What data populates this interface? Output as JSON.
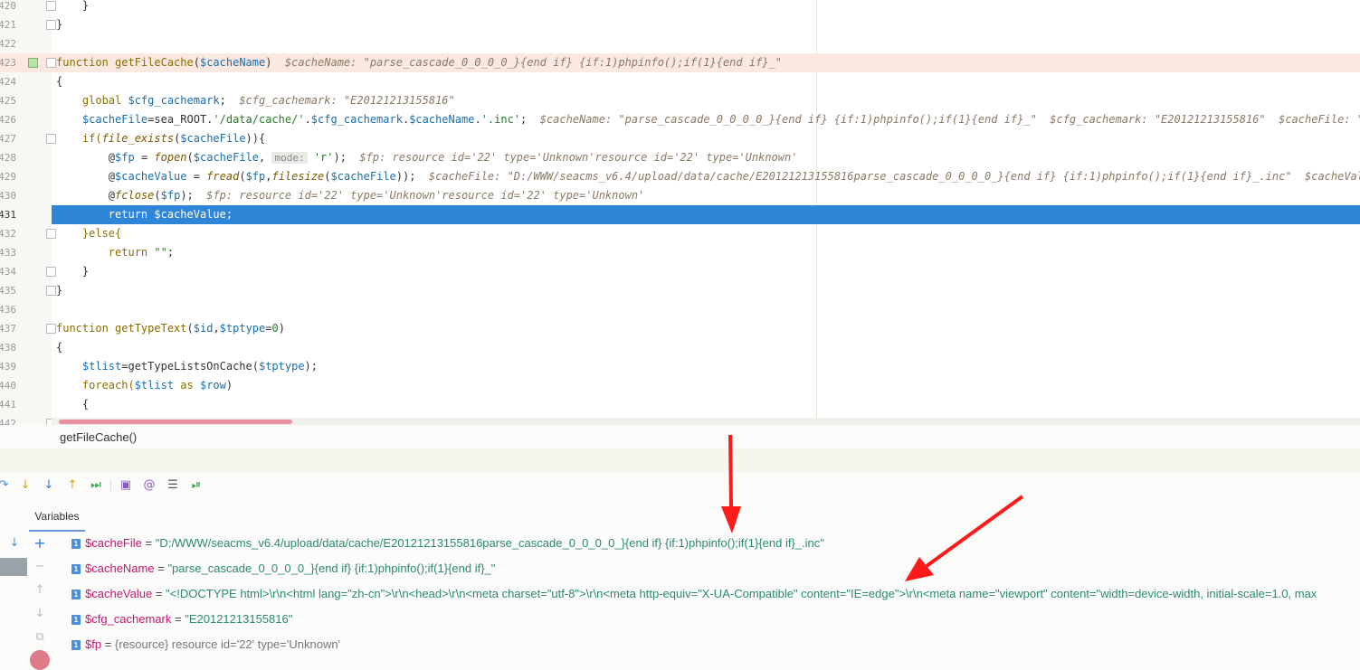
{
  "editor": {
    "lines": [
      {
        "num": "420",
        "segments": [
          {
            "t": "    }",
            "c": ""
          }
        ]
      },
      {
        "num": "421",
        "segments": [
          {
            "t": "}",
            "c": ""
          }
        ]
      },
      {
        "num": "422",
        "segments": []
      },
      {
        "num": "423",
        "segments": [
          {
            "t": "function ",
            "c": "kw"
          },
          {
            "t": "getFileCache",
            "c": "fn"
          },
          {
            "t": "(",
            "c": ""
          },
          {
            "t": "$cacheName",
            "c": "var"
          },
          {
            "t": ")  ",
            "c": ""
          },
          {
            "t": "$cacheName: \"parse_cascade_0_0_0_0_}{end if} {if:1)phpinfo();if(1}{end if}_\"",
            "c": "hint"
          }
        ]
      },
      {
        "num": "424",
        "segments": [
          {
            "t": "{",
            "c": ""
          }
        ]
      },
      {
        "num": "425",
        "segments": [
          {
            "t": "    global ",
            "c": "kw"
          },
          {
            "t": "$cfg_cachemark",
            "c": "var"
          },
          {
            "t": ";  ",
            "c": ""
          },
          {
            "t": "$cfg_cachemark: \"E20121213155816\"",
            "c": "hint"
          }
        ]
      },
      {
        "num": "426",
        "segments": [
          {
            "t": "    $cacheFile",
            "c": "var"
          },
          {
            "t": "=sea_ROOT.",
            "c": ""
          },
          {
            "t": "'/data/cache/'",
            "c": "str"
          },
          {
            "t": ".",
            "c": ""
          },
          {
            "t": "$cfg_cachemark",
            "c": "var"
          },
          {
            "t": ".",
            "c": ""
          },
          {
            "t": "$cacheName",
            "c": "var"
          },
          {
            "t": ".",
            "c": ""
          },
          {
            "t": "'.inc'",
            "c": "str"
          },
          {
            "t": ";  ",
            "c": ""
          },
          {
            "t": "$cacheName: \"parse_cascade_0_0_0_0_}{end if} {if:1)phpinfo();if(1}{end if}_\"  $cfg_cachemark: \"E20121213155816\"  $cacheFile: \"D:/WWW",
            "c": "hint"
          }
        ]
      },
      {
        "num": "427",
        "segments": [
          {
            "t": "    if(",
            "c": "kw"
          },
          {
            "t": "file_exists",
            "c": "italic-fn"
          },
          {
            "t": "(",
            "c": ""
          },
          {
            "t": "$cacheFile",
            "c": "var"
          },
          {
            "t": ")){",
            "c": ""
          }
        ]
      },
      {
        "num": "428",
        "segments": [
          {
            "t": "        @",
            "c": ""
          },
          {
            "t": "$fp",
            "c": "var"
          },
          {
            "t": " = ",
            "c": ""
          },
          {
            "t": "fopen",
            "c": "italic-fn"
          },
          {
            "t": "(",
            "c": ""
          },
          {
            "t": "$cacheFile",
            "c": "var"
          },
          {
            "t": ", ",
            "c": ""
          },
          {
            "t": "mode:",
            "c": "chip"
          },
          {
            "t": " 'r'",
            "c": "str"
          },
          {
            "t": ");  ",
            "c": ""
          },
          {
            "t": "$fp: resource id='22' type='Unknown'resource id='22' type='Unknown'",
            "c": "hint"
          }
        ]
      },
      {
        "num": "429",
        "segments": [
          {
            "t": "        @",
            "c": ""
          },
          {
            "t": "$cacheValue",
            "c": "var"
          },
          {
            "t": " = ",
            "c": ""
          },
          {
            "t": "fread",
            "c": "italic-fn"
          },
          {
            "t": "(",
            "c": ""
          },
          {
            "t": "$fp",
            "c": "var"
          },
          {
            "t": ",",
            "c": ""
          },
          {
            "t": "filesize",
            "c": "italic-fn"
          },
          {
            "t": "(",
            "c": ""
          },
          {
            "t": "$cacheFile",
            "c": "var"
          },
          {
            "t": "));  ",
            "c": ""
          },
          {
            "t": "$cacheFile: \"D:/WWW/seacms_v6.4/upload/data/cache/E20121213155816parse_cascade_0_0_0_0_}{end if} {if:1)phpinfo();if(1}{end if}_.inc\"  $cacheValue: \"<",
            "c": "hint"
          }
        ]
      },
      {
        "num": "430",
        "segments": [
          {
            "t": "        @",
            "c": ""
          },
          {
            "t": "fclose",
            "c": "italic-fn"
          },
          {
            "t": "(",
            "c": ""
          },
          {
            "t": "$fp",
            "c": "var"
          },
          {
            "t": ");  ",
            "c": ""
          },
          {
            "t": "$fp: resource id='22' type='Unknown'resource id='22' type='Unknown'",
            "c": "hint"
          }
        ]
      },
      {
        "num": "431",
        "segments": [
          {
            "t": "        return $cacheValue;",
            "c": ""
          }
        ]
      },
      {
        "num": "432",
        "segments": [
          {
            "t": "    }else{",
            "c": "kw"
          }
        ]
      },
      {
        "num": "433",
        "segments": [
          {
            "t": "        return ",
            "c": "kw"
          },
          {
            "t": "\"\"",
            "c": "str"
          },
          {
            "t": ";",
            "c": ""
          }
        ]
      },
      {
        "num": "434",
        "segments": [
          {
            "t": "    }",
            "c": ""
          }
        ]
      },
      {
        "num": "435",
        "segments": [
          {
            "t": "}",
            "c": ""
          }
        ]
      },
      {
        "num": "436",
        "segments": []
      },
      {
        "num": "437",
        "segments": [
          {
            "t": "function ",
            "c": "kw"
          },
          {
            "t": "getTypeText",
            "c": "fn"
          },
          {
            "t": "(",
            "c": ""
          },
          {
            "t": "$id",
            "c": "var"
          },
          {
            "t": ",",
            "c": ""
          },
          {
            "t": "$tptype",
            "c": "var"
          },
          {
            "t": "=",
            "c": ""
          },
          {
            "t": "0",
            "c": "str"
          },
          {
            "t": ")",
            "c": ""
          }
        ]
      },
      {
        "num": "438",
        "segments": [
          {
            "t": "{",
            "c": ""
          }
        ]
      },
      {
        "num": "439",
        "segments": [
          {
            "t": "    $tlist",
            "c": "var"
          },
          {
            "t": "=getTypeListsOnCache(",
            "c": ""
          },
          {
            "t": "$tptype",
            "c": "var"
          },
          {
            "t": ");",
            "c": ""
          }
        ]
      },
      {
        "num": "440",
        "segments": [
          {
            "t": "    foreach(",
            "c": "kw"
          },
          {
            "t": "$tlist",
            "c": "var"
          },
          {
            "t": " as ",
            "c": "kw"
          },
          {
            "t": "$row",
            "c": "var"
          },
          {
            "t": ")",
            "c": ""
          }
        ]
      },
      {
        "num": "441",
        "segments": [
          {
            "t": "    {",
            "c": ""
          }
        ]
      },
      {
        "num": "442",
        "segments": []
      }
    ]
  },
  "breadcrumb": "getFileCache()",
  "debugger": {
    "tab": "Variables",
    "variables": [
      {
        "name": "$cacheFile",
        "eq": " = ",
        "value": "\"D:/WWW/seacms_v6.4/upload/data/cache/E20121213155816parse_cascade_0_0_0_0_}{end if} {if:1)phpinfo();if(1}{end if}_.inc\""
      },
      {
        "name": "$cacheName",
        "eq": " = ",
        "value": "\"parse_cascade_0_0_0_0_}{end if} {if:1)phpinfo();if(1}{end if}_\""
      },
      {
        "name": "$cacheValue",
        "eq": " = ",
        "value": "\"<!DOCTYPE html>\\r\\n<html lang=\"zh-cn\">\\r\\n<head>\\r\\n<meta charset=\"utf-8\">\\r\\n<meta http-equiv=\"X-UA-Compatible\" content=\"IE=edge\">\\r\\n<meta name=\"viewport\" content=\"width=device-width, initial-scale=1.0, max"
      },
      {
        "name": "$cfg_cachemark",
        "eq": " = ",
        "value": "\"E20121213155816\""
      },
      {
        "name": "$fp",
        "eq": " = ",
        "value": "{resource} resource id='22' type='Unknown'"
      }
    ],
    "badge": "1"
  },
  "colors": {
    "selection": "#2f86d8",
    "highlight_line": "#fbe9e1",
    "arrow": "#ff1a1a"
  }
}
